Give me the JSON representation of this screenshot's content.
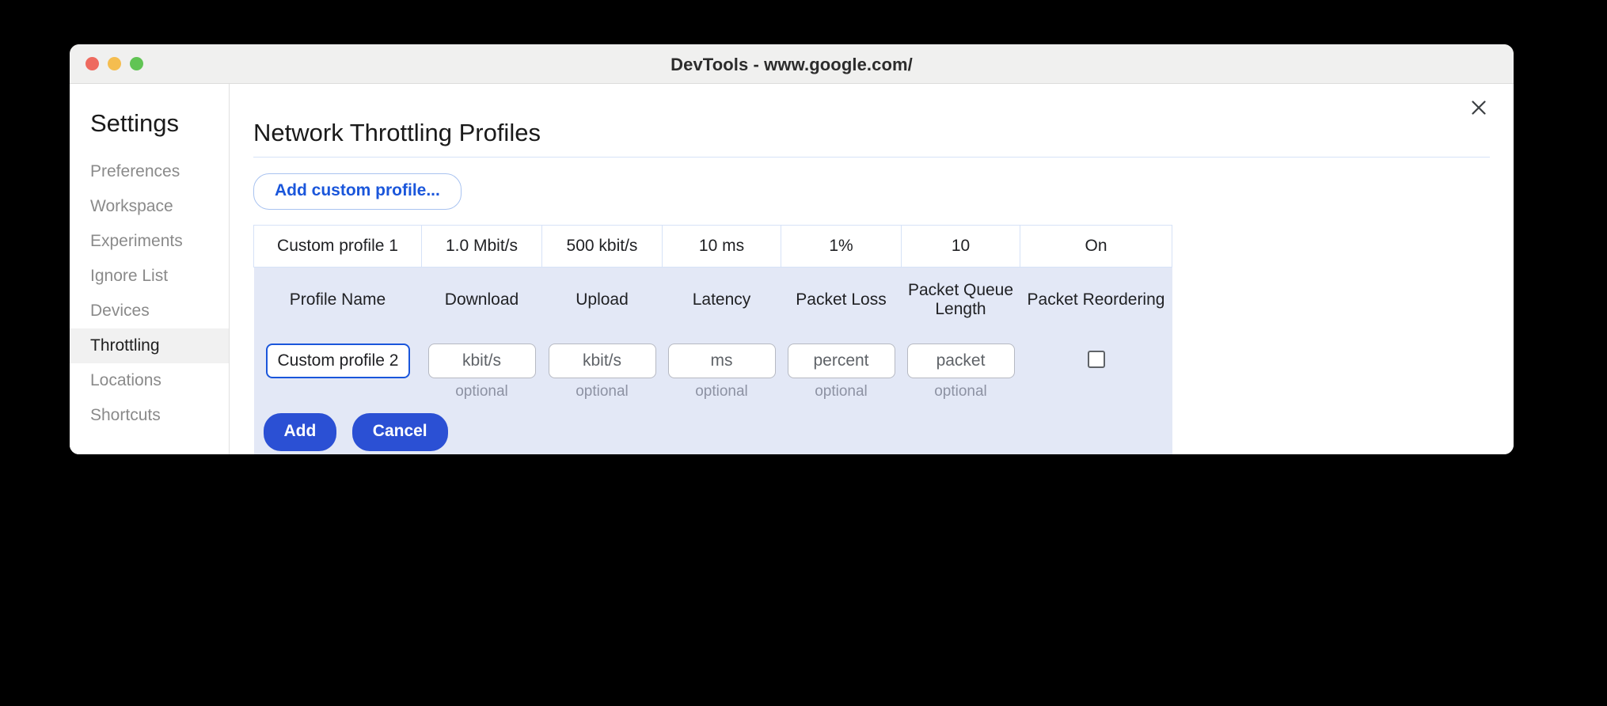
{
  "window": {
    "title": "DevTools - www.google.com/",
    "traffic_lights": [
      "close-red",
      "minimize-yellow",
      "maximize-green"
    ]
  },
  "sidebar": {
    "heading": "Settings",
    "items": [
      {
        "label": "Preferences",
        "selected": false
      },
      {
        "label": "Workspace",
        "selected": false
      },
      {
        "label": "Experiments",
        "selected": false
      },
      {
        "label": "Ignore List",
        "selected": false
      },
      {
        "label": "Devices",
        "selected": false
      },
      {
        "label": "Throttling",
        "selected": true
      },
      {
        "label": "Locations",
        "selected": false
      },
      {
        "label": "Shortcuts",
        "selected": false
      }
    ]
  },
  "content": {
    "page_title": "Network Throttling Profiles",
    "close_icon": "close-icon",
    "add_profile_button": "Add custom profile...",
    "table": {
      "headers": [
        "Profile Name",
        "Download",
        "Upload",
        "Latency",
        "Packet Loss",
        "Packet Queue Length",
        "Packet Reordering"
      ],
      "existing_profile": {
        "profile_name": "Custom profile 1",
        "download": "1.0 Mbit/s",
        "upload": "500 kbit/s",
        "latency": "10 ms",
        "packet_loss": "1%",
        "packet_queue_length": "10",
        "packet_reordering": "On"
      },
      "new_profile_form": {
        "profile_name_value": "Custom profile 2",
        "profile_name_placeholder": "Profile Name",
        "download_value": "",
        "download_placeholder": "kbit/s",
        "upload_value": "",
        "upload_placeholder": "kbit/s",
        "latency_value": "",
        "latency_placeholder": "ms",
        "packet_loss_value": "",
        "packet_loss_placeholder": "percent",
        "packet_queue_value": "",
        "packet_queue_placeholder": "packet",
        "packet_reordering_checked": false,
        "optional_label": "optional"
      },
      "buttons": {
        "add": "Add",
        "cancel": "Cancel"
      }
    }
  },
  "colors": {
    "accent_blue": "#2b50d4",
    "link_blue": "#1a56db",
    "row_highlight": "#e3e8f6",
    "table_border": "#d6e2f7",
    "sidebar_selected": "#f1f1f1",
    "titlebar": "#f0f0ef"
  }
}
